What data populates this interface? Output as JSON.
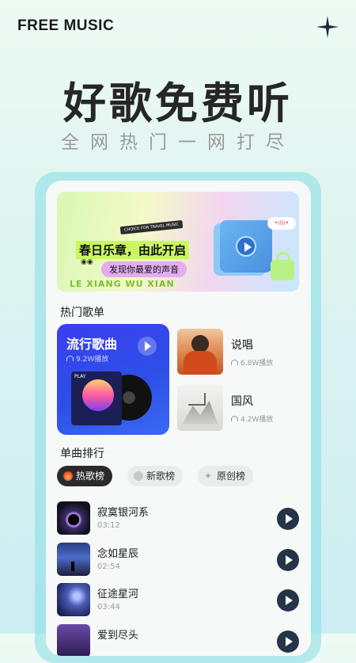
{
  "app": {
    "title": "FREE MUSIC"
  },
  "hero": {
    "headline": "好歌免费听",
    "subline": "全网热门一网打尽"
  },
  "banner": {
    "tag": "CHOICE FOR TRAVEL MUSIC",
    "title": "春日乐章，由此开启",
    "subtitle": "发现你最爱的声音",
    "en": "LE XIANG WU XIAN"
  },
  "hot_playlists": {
    "title": "热门歌单",
    "items": [
      {
        "name": "流行歌曲",
        "plays": "9.2W播放",
        "cover_text": "PLAY"
      },
      {
        "name": "说唱",
        "plays": "6.8W播放"
      },
      {
        "name": "国风",
        "plays": "4.2W播放"
      }
    ]
  },
  "charts": {
    "title": "单曲排行",
    "tabs": [
      {
        "label": "热歌榜",
        "icon": "fire-icon",
        "active": true
      },
      {
        "label": "新歌榜",
        "icon": "new-icon",
        "active": false
      },
      {
        "label": "原创榜",
        "icon": "sparkle-icon",
        "active": false
      }
    ],
    "songs": [
      {
        "title": "寂寞银河系",
        "duration": "03:12"
      },
      {
        "title": "念如星辰",
        "duration": "02:54"
      },
      {
        "title": "征途星河",
        "duration": "03:44"
      },
      {
        "title": "爱到尽头",
        "duration": ""
      }
    ]
  }
}
